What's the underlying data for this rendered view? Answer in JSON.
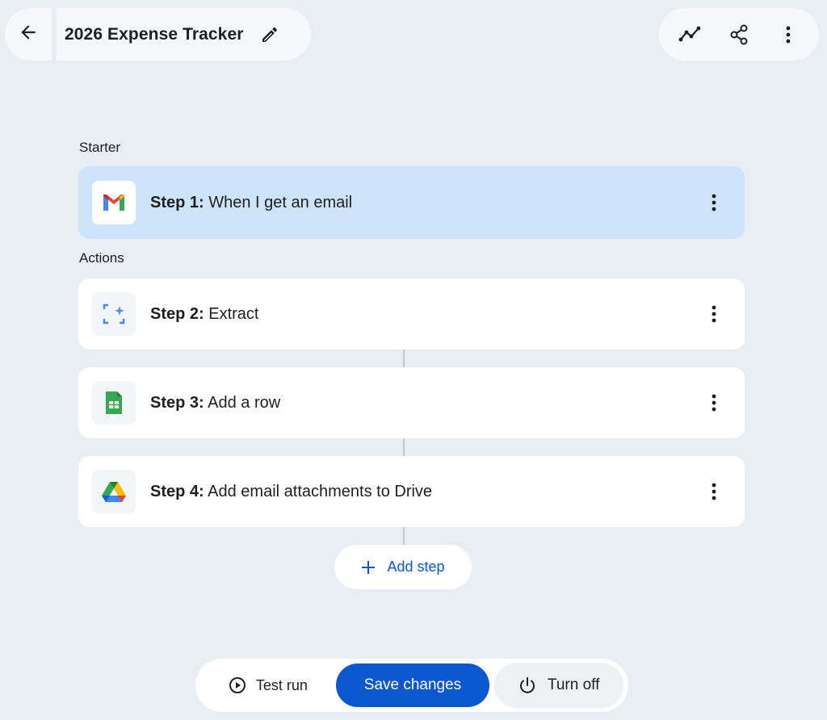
{
  "header": {
    "title": "2026 Expense Tracker",
    "back_icon": "arrow-back-icon",
    "edit_icon": "pencil-icon",
    "actions": [
      "activity-icon",
      "share-icon",
      "more-vert-icon"
    ]
  },
  "sections": {
    "starter_label": "Starter",
    "actions_label": "Actions"
  },
  "steps": [
    {
      "prefix": "Step 1:",
      "text": " When I get an email",
      "icon": "gmail-icon",
      "selected": true
    },
    {
      "prefix": "Step 2:",
      "text": " Extract",
      "icon": "extract-sparkle-icon",
      "selected": false
    },
    {
      "prefix": "Step 3:",
      "text": " Add a row",
      "icon": "sheets-icon",
      "selected": false
    },
    {
      "prefix": "Step 4:",
      "text": " Add email attachments to Drive",
      "icon": "drive-icon",
      "selected": false
    }
  ],
  "add_step": {
    "label": "Add step",
    "icon": "plus-icon"
  },
  "footer": {
    "test_run": "Test run",
    "save": "Save changes",
    "turn_off": "Turn off"
  },
  "colors": {
    "background": "#e9edf4",
    "accent": "#0b57d0",
    "selected_card": "#cde4fa"
  }
}
